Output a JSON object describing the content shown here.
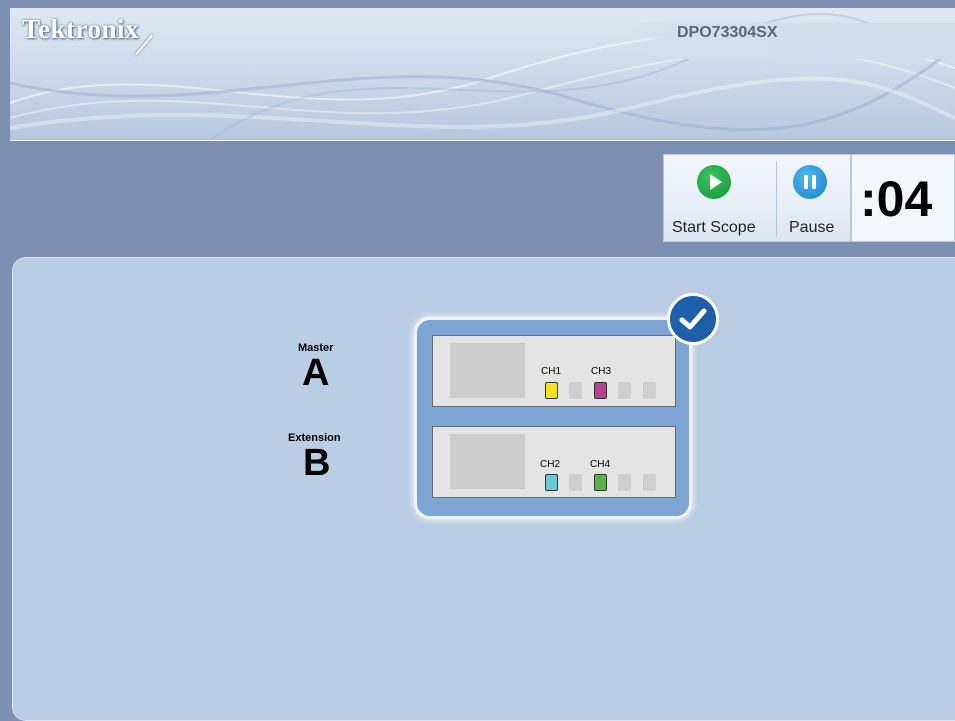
{
  "header": {
    "brand": "Tektronix",
    "model": "DPO73304SX"
  },
  "toolbar": {
    "start_label": "Start Scope",
    "pause_label": "Pause",
    "start_icon": "play-icon",
    "pause_icon": "pause-icon",
    "start_color": "#22a34a",
    "pause_color": "#2a93d4"
  },
  "timer": {
    "value": ":04"
  },
  "configuration": {
    "selected": true,
    "units": [
      {
        "role": "Master",
        "letter": "A",
        "channels": [
          {
            "name": "CH1",
            "color": "#f2e31c"
          },
          {
            "name": "CH3",
            "color": "#b5448e"
          }
        ]
      },
      {
        "role": "Extension",
        "letter": "B",
        "channels": [
          {
            "name": "CH2",
            "color": "#6ec8d8"
          },
          {
            "name": "CH4",
            "color": "#5bb14b"
          }
        ]
      }
    ]
  }
}
